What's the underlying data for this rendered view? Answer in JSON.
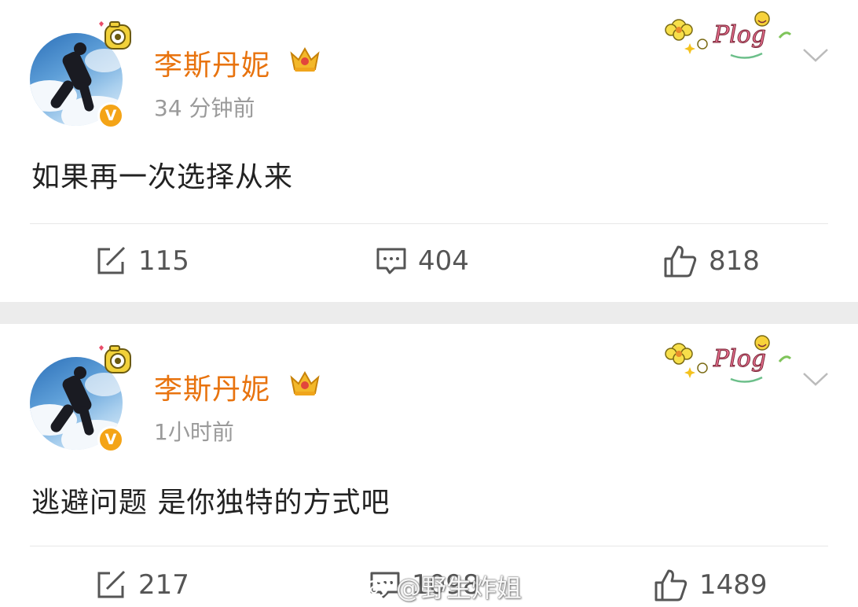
{
  "posts": [
    {
      "author": "李斯丹妮",
      "time": "34 分钟前",
      "text": "如果再一次选择从来",
      "sticker_text": "Plog",
      "actions": {
        "reposts": "115",
        "comments": "404",
        "likes": "818"
      }
    },
    {
      "author": "李斯丹妮",
      "time": "1小时前",
      "text": "逃避问题 是你独特的方式吧",
      "sticker_text": "Plog",
      "actions": {
        "reposts": "217",
        "comments": "1098",
        "likes": "1489"
      }
    }
  ],
  "watermark": {
    "text": "@野生炸姐"
  },
  "icons": {
    "verified": "verified-v-icon",
    "crown": "crown-icon",
    "repost": "repost-icon",
    "comment": "comment-icon",
    "like": "like-icon",
    "more": "chevron-down-icon"
  },
  "colors": {
    "name": "#e8730e",
    "time": "#9a9a9a",
    "text": "#222222",
    "badge": "#f4a417",
    "separator": "#ececec"
  }
}
